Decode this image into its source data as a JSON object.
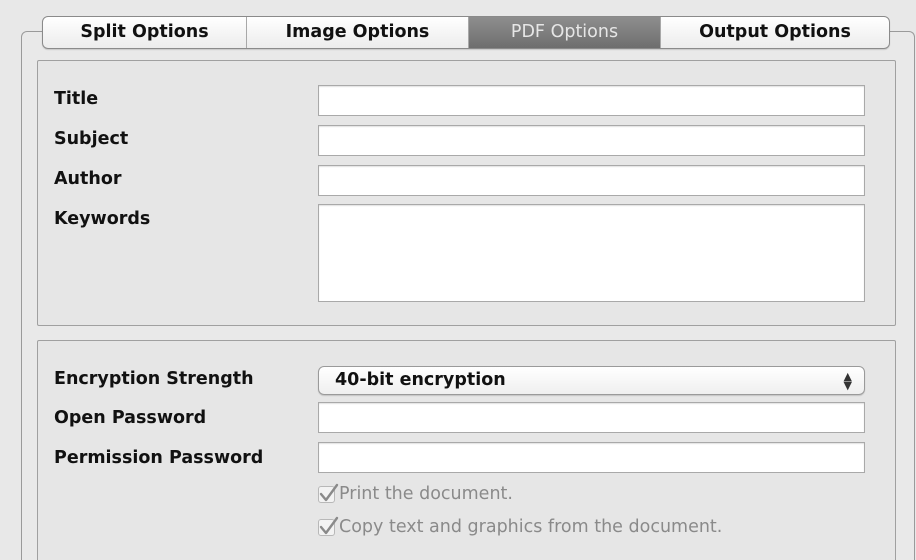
{
  "tabs": [
    {
      "label": "Split Options",
      "selected": false
    },
    {
      "label": "Image Options",
      "selected": false
    },
    {
      "label": "PDF Options",
      "selected": true
    },
    {
      "label": "Output Options",
      "selected": false
    }
  ],
  "metadata": {
    "title_label": "Title",
    "title_value": "",
    "subject_label": "Subject",
    "subject_value": "",
    "author_label": "Author",
    "author_value": "",
    "keywords_label": "Keywords",
    "keywords_value": ""
  },
  "security": {
    "encryption_label": "Encryption Strength",
    "encryption_value": "40-bit encryption",
    "open_password_label": "Open Password",
    "open_password_value": "",
    "permission_password_label": "Permission Password",
    "permission_password_value": "",
    "print_label": "Print the document.",
    "print_checked": true,
    "copy_label": "Copy text and graphics from the document.",
    "copy_checked": true
  },
  "colors": {
    "selected_tab": "#7a7a7a",
    "disabled_text": "#8a8a8a"
  }
}
